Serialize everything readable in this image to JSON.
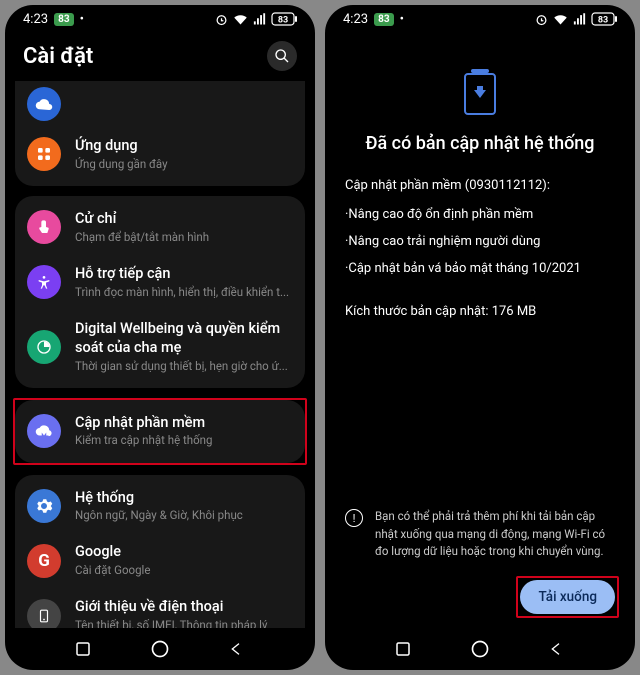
{
  "status": {
    "time": "4:23",
    "battery_small": "83",
    "battery_right": "83"
  },
  "left": {
    "headerTitle": "Cài đặt",
    "partialRow": {
      "sub": ""
    },
    "apps": {
      "title": "Ứng dụng",
      "sub": "Ứng dụng gần đây"
    },
    "gestures": {
      "title": "Cử chỉ",
      "sub": "Chạm để bật/tắt màn hình"
    },
    "accessibility": {
      "title": "Hỗ trợ tiếp cận",
      "sub": "Trình đọc màn hình, hiển thị, điều khiển t..."
    },
    "wellbeing": {
      "title": "Digital Wellbeing và quyền kiểm soát của cha mẹ",
      "sub": "Thời gian sử dụng thiết bị, hẹn giờ cho ứ..."
    },
    "update": {
      "title": "Cập nhật phần mềm",
      "sub": "Kiểm tra cập nhật hệ thống"
    },
    "system": {
      "title": "Hệ thống",
      "sub": "Ngôn ngữ, Ngày & Giờ, Khôi phục"
    },
    "google": {
      "title": "Google",
      "sub": "Cài đặt Google"
    },
    "about": {
      "title": "Giới thiệu về điện thoại",
      "sub": "Tên thiết bị, số IMEI, Thông tin pháp lý"
    }
  },
  "right": {
    "title": "Đã có bản cập nhật hệ thống",
    "subtitle": "Cập nhật phần mềm (0930112112):",
    "bullets": [
      "·Nâng cao độ ổn định phần mềm",
      "·Nâng cao trải nghiệm người dùng",
      "·Cập nhật bản vá bảo mật tháng 10/2021"
    ],
    "size": "Kích thước bản cập nhật: 176 MB",
    "warningIcon": "!",
    "warning": "Bạn có thể phải trả thêm phí khi tải bản cập nhật xuống qua mạng di động, mạng Wi-Fi có đo lượng dữ liệu hoặc trong khi chuyển vùng.",
    "downloadLabel": "Tải xuống"
  },
  "colors": {
    "highlight": "#d0021b"
  }
}
